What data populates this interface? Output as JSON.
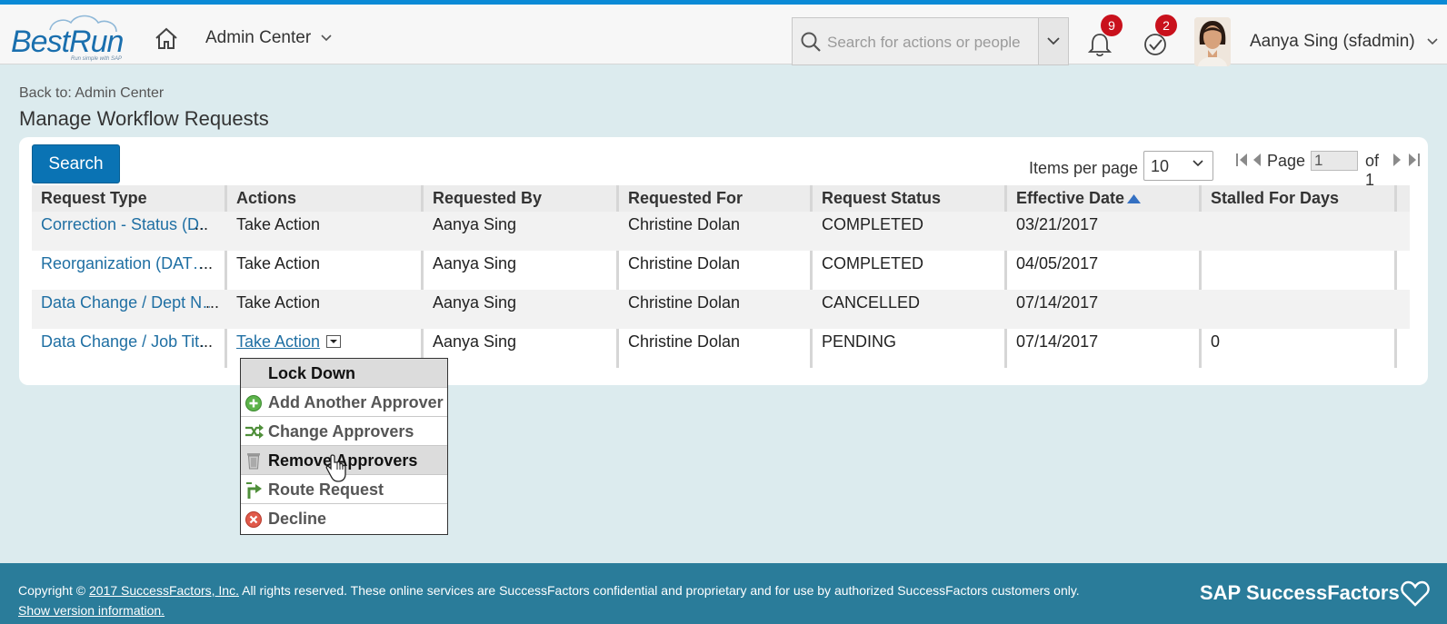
{
  "header": {
    "logo_text": "BestRun",
    "logo_tagline": "Run simple with SAP",
    "module_title": "Admin Center",
    "search_placeholder": "Search for actions or people",
    "notifications_count": "9",
    "tasks_count": "2",
    "user_name": "Aanya Sing (sfadmin)",
    "accent_color": "#0a8ad6",
    "badge_color": "#c9111c"
  },
  "page": {
    "back_link": "Back to: Admin Center",
    "title": "Manage Workflow Requests"
  },
  "toolbar": {
    "search_button": "Search",
    "items_per_page_label": "Items per page",
    "items_per_page_value": "10",
    "page_label": "Page",
    "page_value": "1",
    "page_of": "of 1"
  },
  "table": {
    "columns": [
      "Request Type",
      "Actions",
      "Requested By",
      "Requested For",
      "Request Status",
      "Effective Date",
      "Stalled For Days"
    ],
    "sorted_column": "Effective Date",
    "sort_direction": "ascending",
    "rows": [
      {
        "type": "Correction - Status (D…",
        "more": "...",
        "action": "Take Action",
        "by": "Aanya Sing",
        "for": "Christine Dolan",
        "status": "COMPLETED",
        "date": "03/21/2017",
        "stalled": ""
      },
      {
        "type": "Reorganization (DAT…",
        "more": "...",
        "action": "Take Action",
        "by": "Aanya Sing",
        "for": "Christine Dolan",
        "status": "COMPLETED",
        "date": "04/05/2017",
        "stalled": ""
      },
      {
        "type": "Data Change / Dept N…",
        "more": "...",
        "action": "Take Action",
        "by": "Aanya Sing",
        "for": "Christine Dolan",
        "status": "CANCELLED",
        "date": "07/14/2017",
        "stalled": ""
      },
      {
        "type": "Data Change / Job Tit…",
        "more": "...",
        "action": "Take Action",
        "by": "Aanya Sing",
        "for": "Christine Dolan",
        "status": "PENDING",
        "date": "07/14/2017",
        "stalled": "0"
      }
    ]
  },
  "action_menu": {
    "items": [
      {
        "label": "Lock Down",
        "icon": "none"
      },
      {
        "label": "Add Another Approver",
        "icon": "add-icon"
      },
      {
        "label": "Change Approvers",
        "icon": "swap-icon"
      },
      {
        "label": "Remove Approvers",
        "icon": "trash-icon"
      },
      {
        "label": "Route Request",
        "icon": "route-icon"
      },
      {
        "label": "Decline",
        "icon": "decline-icon"
      }
    ],
    "hovered_item": "Remove Approvers"
  },
  "footer": {
    "copyright_prefix": "Copyright ©",
    "copyright_link": "2017 SuccessFactors, Inc.",
    "copyright_suffix": "All rights reserved. These online services are SuccessFactors confidential and proprietary and for use by authorized SuccessFactors customers only.",
    "version_link": "Show version information.",
    "brand": "SAP SuccessFactors"
  }
}
